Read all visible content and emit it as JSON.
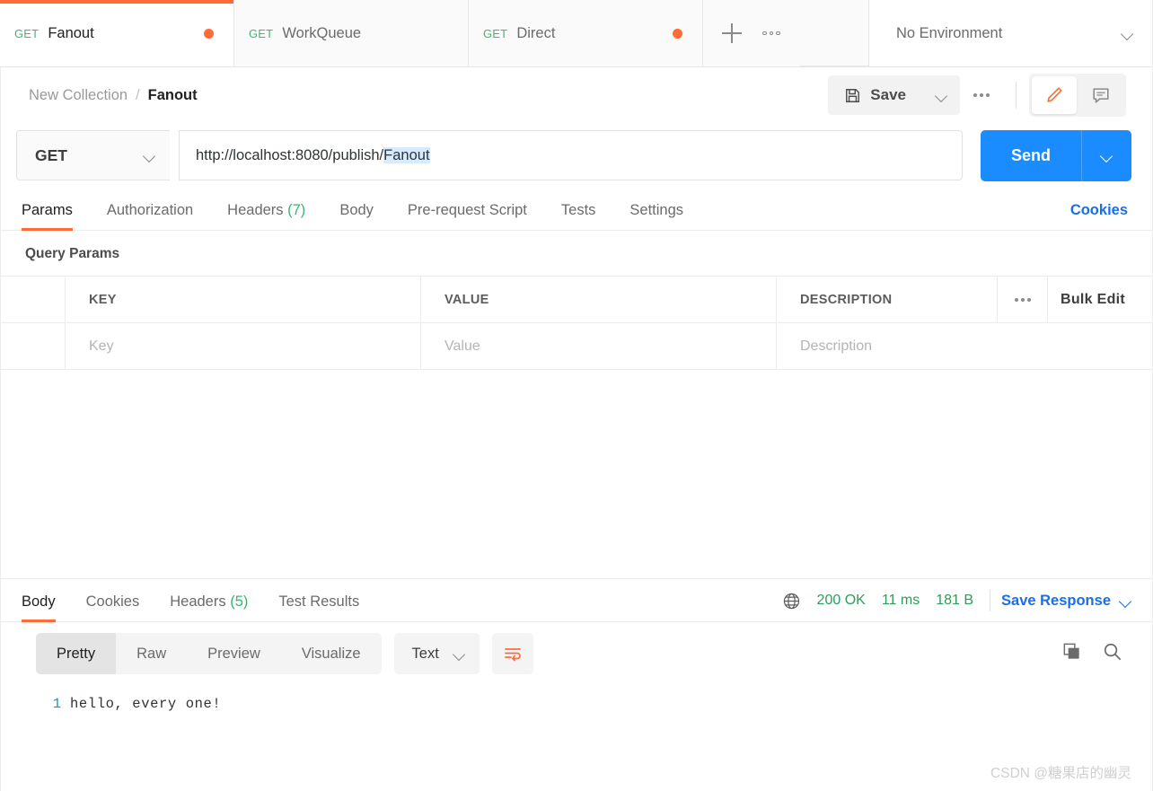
{
  "tabbar": {
    "tabs": [
      {
        "method": "GET",
        "name": "Fanout",
        "unsaved": true,
        "active": true
      },
      {
        "method": "GET",
        "name": "WorkQueue",
        "unsaved": false,
        "active": false
      },
      {
        "method": "GET",
        "name": "Direct",
        "unsaved": true,
        "active": false
      }
    ],
    "new_tab_icon": "plus-icon",
    "more_icon": "more-horizontal-icon",
    "environment": {
      "label": "No Environment",
      "chevron": "chevron-down-icon"
    }
  },
  "breadcrumb": {
    "collection": "New Collection",
    "separator": "/",
    "current": "Fanout"
  },
  "toolbar": {
    "save_label": "Save",
    "save_icon": "floppy-disk-icon",
    "save_caret_icon": "chevron-down-icon",
    "more_icon": "more-horizontal-icon",
    "edit_icon": "pencil-icon",
    "comment_icon": "comment-icon",
    "accent": "#ff6c37"
  },
  "request": {
    "method": "GET",
    "method_caret_icon": "chevron-down-icon",
    "url_prefix": "http://localhost:8080/publish/",
    "url_selected": "Fanout",
    "url_full": "http://localhost:8080/publish/Fanout",
    "send_label": "Send",
    "send_caret_icon": "chevron-down-icon",
    "send_color": "#1a8cff",
    "tabs": [
      {
        "label": "Params",
        "count": "",
        "active": true
      },
      {
        "label": "Authorization",
        "count": "",
        "active": false
      },
      {
        "label": "Headers",
        "count": "(7)",
        "active": false
      },
      {
        "label": "Body",
        "count": "",
        "active": false
      },
      {
        "label": "Pre-request Script",
        "count": "",
        "active": false
      },
      {
        "label": "Tests",
        "count": "",
        "active": false
      },
      {
        "label": "Settings",
        "count": "",
        "active": false
      }
    ],
    "cookies_link": "Cookies"
  },
  "query_params": {
    "title": "Query Params",
    "columns": [
      "KEY",
      "VALUE",
      "DESCRIPTION"
    ],
    "options_icon": "more-horizontal-icon",
    "bulk_edit": "Bulk Edit",
    "rows": [
      {
        "key_placeholder": "Key",
        "value_placeholder": "Value",
        "description_placeholder": "Description"
      }
    ]
  },
  "response": {
    "tabs": [
      {
        "label": "Body",
        "count": "",
        "active": true
      },
      {
        "label": "Cookies",
        "count": "",
        "active": false
      },
      {
        "label": "Headers",
        "count": "(5)",
        "active": false
      },
      {
        "label": "Test Results",
        "count": "",
        "active": false
      }
    ],
    "globe_icon": "globe-icon",
    "status": "200 OK",
    "time": "11 ms",
    "size": "181 B",
    "status_color": "#2e9c5a",
    "save_response": "Save Response",
    "save_response_caret_icon": "chevron-down-icon",
    "view_modes": [
      {
        "label": "Pretty",
        "active": true
      },
      {
        "label": "Raw",
        "active": false
      },
      {
        "label": "Preview",
        "active": false
      },
      {
        "label": "Visualize",
        "active": false
      }
    ],
    "format": "Text",
    "format_caret_icon": "chevron-down-icon",
    "wrap_icon": "word-wrap-icon",
    "copy_icon": "copy-icon",
    "search_icon": "search-icon",
    "body_lines": [
      {
        "number": "1",
        "text": "hello, every one!"
      }
    ]
  },
  "watermark": "CSDN @糖果店的幽灵"
}
